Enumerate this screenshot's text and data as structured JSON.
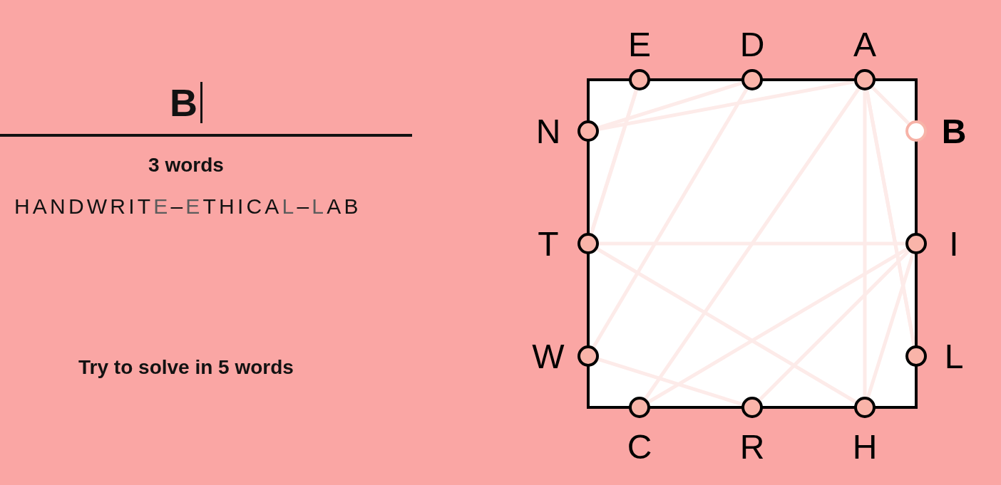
{
  "entry": {
    "value": "B"
  },
  "word_count": "3 words",
  "solution": [
    {
      "text": "HANDWRIT",
      "joint": false
    },
    {
      "text": "E",
      "joint": true
    },
    {
      "text": "–",
      "joint": false
    },
    {
      "text": "E",
      "joint": true
    },
    {
      "text": "THICA",
      "joint": false
    },
    {
      "text": "L",
      "joint": true
    },
    {
      "text": "–",
      "joint": false
    },
    {
      "text": "L",
      "joint": true
    },
    {
      "text": "AB",
      "joint": false
    }
  ],
  "goal": "Try to solve in 5 words",
  "board": {
    "sides": [
      {
        "kind": "top",
        "letters": [
          {
            "letter": "E",
            "selected": false
          },
          {
            "letter": "D",
            "selected": false
          },
          {
            "letter": "A",
            "selected": false
          }
        ]
      },
      {
        "kind": "right",
        "letters": [
          {
            "letter": "B",
            "selected": true
          },
          {
            "letter": "I",
            "selected": false
          },
          {
            "letter": "L",
            "selected": false
          }
        ]
      },
      {
        "kind": "bottom",
        "letters": [
          {
            "letter": "C",
            "selected": false
          },
          {
            "letter": "R",
            "selected": false
          },
          {
            "letter": "H",
            "selected": false
          }
        ]
      },
      {
        "kind": "left",
        "letters": [
          {
            "letter": "N",
            "selected": false
          },
          {
            "letter": "T",
            "selected": false
          },
          {
            "letter": "W",
            "selected": false
          }
        ]
      }
    ]
  }
}
